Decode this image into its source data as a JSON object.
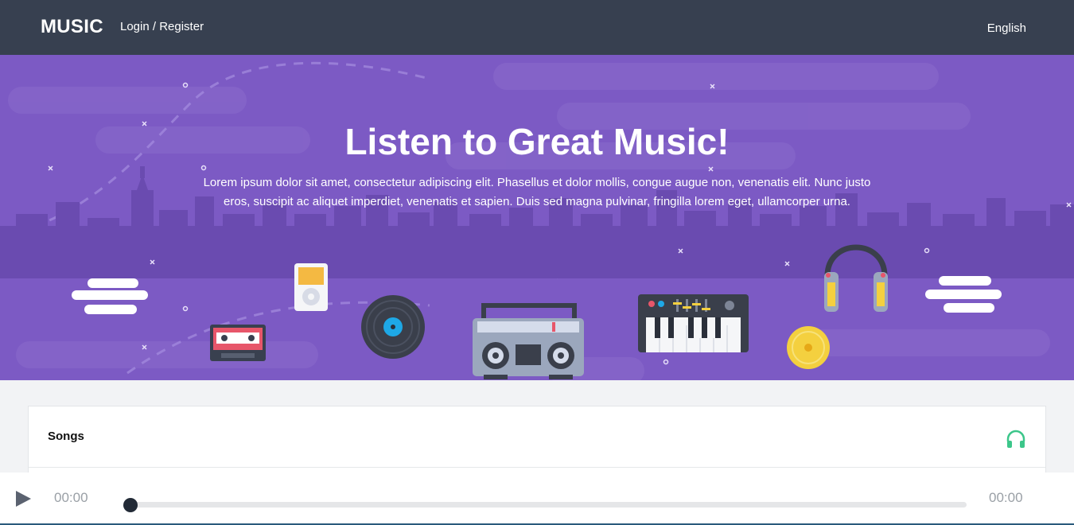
{
  "header": {
    "brand": "MUSIC",
    "login": "Login / Register",
    "language": "English"
  },
  "hero": {
    "title": "Listen to Great Music!",
    "text": "Lorem ipsum dolor sit amet, consectetur adipiscing elit. Phasellus et dolor mollis, congue augue non, venenatis elit. Nunc justo eros, suscipit ac aliquet imperdiet, venenatis et sapien. Duis sed magna pulvinar, fringilla lorem eget, ullamcorper urna."
  },
  "songs": {
    "title": "Songs",
    "icon": "headphones-icon"
  },
  "player": {
    "current_time": "00:00",
    "total_time": "00:00",
    "progress": 0
  },
  "colors": {
    "header_bg": "#374050",
    "hero_bg": "#7c5ac4",
    "accent_green": "#3cc68a"
  }
}
